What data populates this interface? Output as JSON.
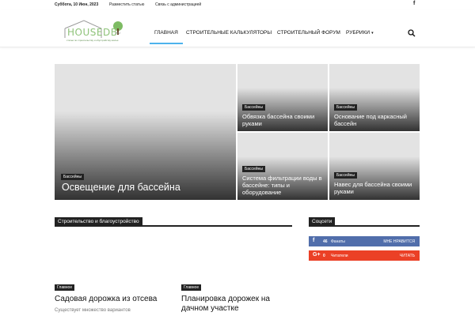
{
  "topbar": {
    "date": "Суббота, 10 Июн, 2023",
    "links": [
      "Разместить статью",
      "Связь с администрацией"
    ],
    "social_icon": "facebook-icon"
  },
  "logo": {
    "text": "HOUSEDB",
    "suffix": ".RU",
    "tagline": "статьи по строительству и обустройству жилья",
    "color": "#8fc37a"
  },
  "nav": {
    "items": [
      "Главная",
      "Строительные калькуляторы",
      "Строительный форум",
      "Рубрики"
    ],
    "accent": "#4db2ec"
  },
  "grid": {
    "tiles": [
      {
        "category": "Бассейны",
        "title": "Освещение для бассейна"
      },
      {
        "category": "Бассейны",
        "title": "Обвязка бассейна своими руками"
      },
      {
        "category": "Бассейны",
        "title": "Основание под каркасный бассейн"
      },
      {
        "category": "Бассейны",
        "title": "Система фильтрации воды в бассейне: типы и оборудование"
      },
      {
        "category": "Бассейны",
        "title": "Навес для бассейна своими руками"
      }
    ]
  },
  "main": {
    "section_title": "Строительство и благоустройство",
    "posts": [
      {
        "category": "Главное",
        "title": "Садовая дорожка из отсева",
        "excerpt": "Существует множество вариантов"
      },
      {
        "category": "Главное",
        "title": "Планировка дорожек на дачном участке",
        "excerpt": ""
      }
    ]
  },
  "sidebar": {
    "section_title": "Соцсети",
    "networks": [
      {
        "icon": "facebook-icon",
        "glyph": "f",
        "count": "46",
        "label": "Фанаты",
        "action": "Мне нравится",
        "color": "#516eab"
      },
      {
        "icon": "google-plus-icon",
        "glyph": "G+",
        "count": "0",
        "label": "Читатели",
        "action": "Читать",
        "color": "#eb4026"
      }
    ]
  }
}
